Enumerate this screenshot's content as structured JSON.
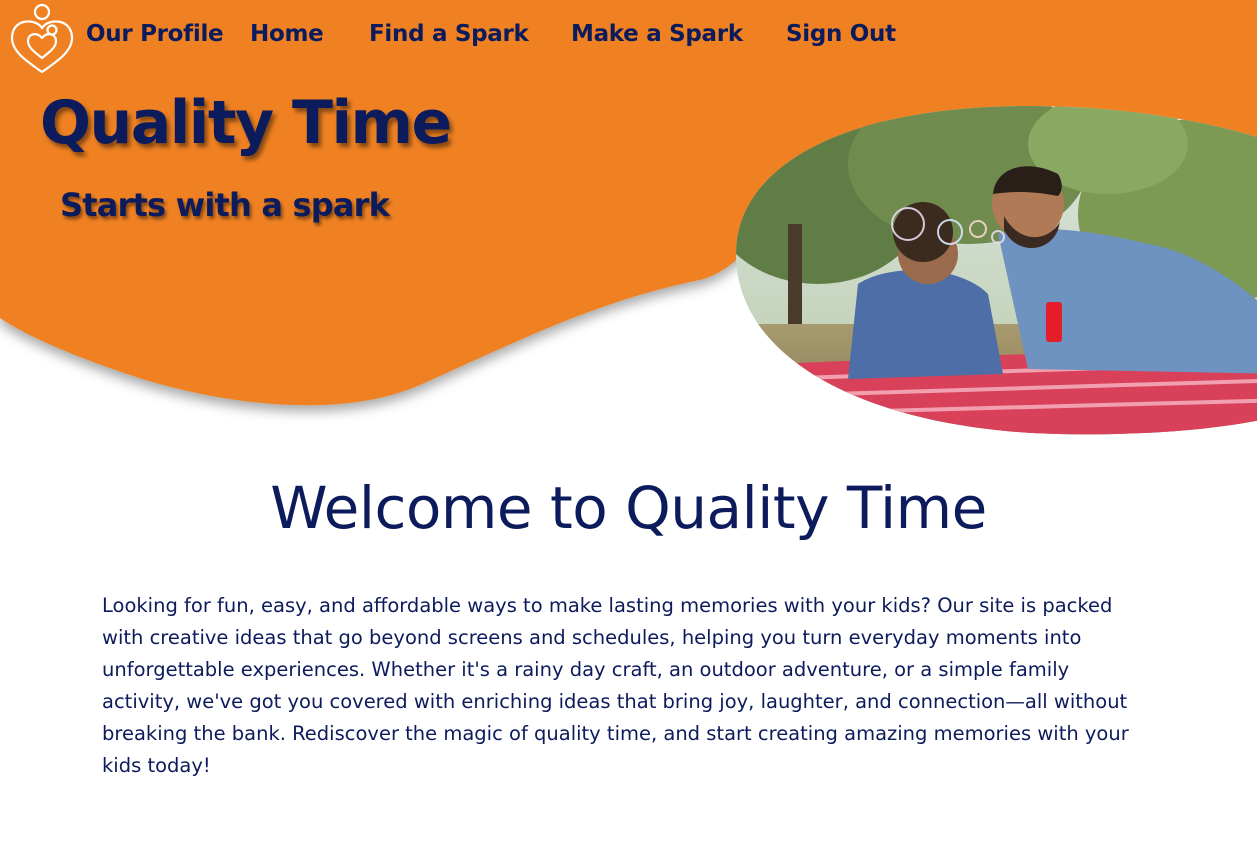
{
  "nav": {
    "logo_icon": "heart-family-icon",
    "items": [
      {
        "label": "Our Profile"
      },
      {
        "label": "Home"
      },
      {
        "label": "Find a Spark"
      },
      {
        "label": "Make a Spark"
      },
      {
        "label": "Sign Out"
      }
    ]
  },
  "hero": {
    "title": "Quality Time",
    "subtitle": "Starts with a spark",
    "photo_icon": "father-child-bubbles-photo"
  },
  "main": {
    "heading": "Welcome to Quality Time",
    "body": "Looking for fun, easy, and affordable ways to make lasting memories with your kids? Our site is packed with creative ideas that go beyond screens and schedules, helping you turn everyday moments into unforgettable experiences. Whether it's a rainy day craft, an outdoor adventure, or a simple family activity, we've got you covered with enriching ideas that bring joy, laughter, and connection—all without breaking the bank. Rediscover the magic of quality time, and start creating amazing memories with your kids today!"
  },
  "colors": {
    "brand_orange": "#ef8121",
    "text_navy": "#0c1b5c",
    "background": "#ffffff"
  }
}
